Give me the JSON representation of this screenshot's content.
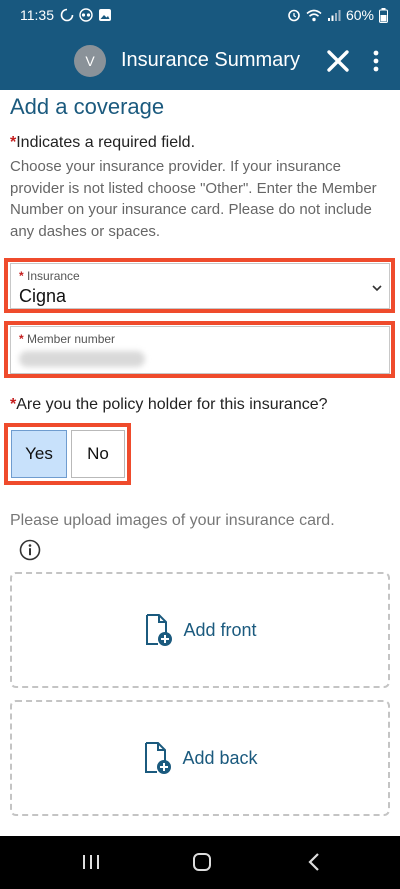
{
  "status_bar": {
    "time": "11:35",
    "battery": "60%",
    "icons": [
      "sync-icon",
      "hidden-eyes-icon",
      "gallery-icon",
      "alarm-icon",
      "wifi-icon",
      "signal-icon",
      "battery-icon"
    ]
  },
  "app_bar": {
    "avatar_initial": "V",
    "title": "Insurance Summary",
    "close_icon": "close-icon",
    "more_icon": "more-vert-icon"
  },
  "form": {
    "heading": "Add a coverage",
    "required_note": "Indicates a required field.",
    "instructions": "Choose your insurance provider. If your insurance provider is not listed choose \"Other\". Enter the Member Number on your insurance card. Please do not include any dashes or spaces.",
    "insurance": {
      "label": "Insurance",
      "value": "Cigna"
    },
    "member_number": {
      "label": "Member number"
    },
    "policy_holder": {
      "question": "Are you the policy holder for this insurance?",
      "yes_label": "Yes",
      "no_label": "No",
      "selected": "Yes"
    },
    "upload": {
      "prompt": "Please upload images of your insurance card.",
      "front_label": "Add front",
      "back_label": "Add back"
    }
  },
  "colors": {
    "brand": "#18587f",
    "link": "#1b5a7e",
    "required": "#c41e1e",
    "highlight": "#ef4b2c",
    "selected_bg": "#c8e1fb"
  }
}
